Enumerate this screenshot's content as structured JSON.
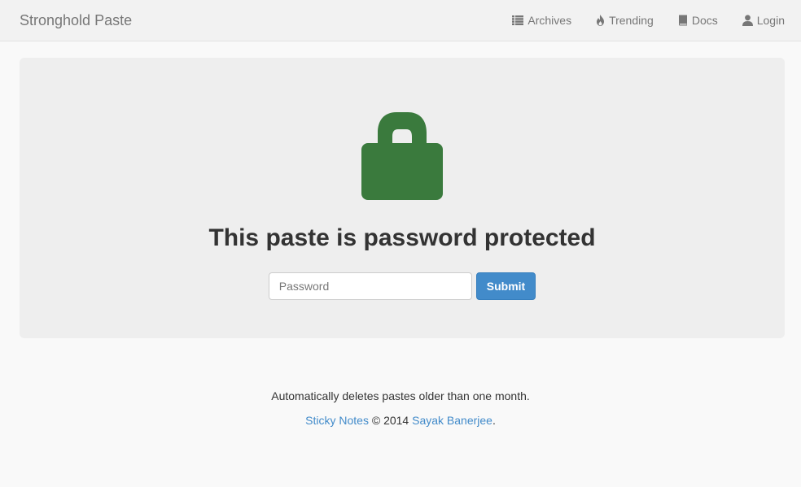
{
  "navbar": {
    "brand": "Stronghold Paste",
    "items": [
      {
        "label": "Archives",
        "icon": "list-icon"
      },
      {
        "label": "Trending",
        "icon": "fire-icon"
      },
      {
        "label": "Docs",
        "icon": "book-icon"
      },
      {
        "label": "Login",
        "icon": "user-icon"
      }
    ]
  },
  "main": {
    "title": "This paste is password protected",
    "password_placeholder": "Password",
    "password_value": "",
    "submit_label": "Submit",
    "lock_icon": "lock-icon",
    "lock_color": "#3a7a3d"
  },
  "footer": {
    "notice": "Automatically deletes pastes older than one month.",
    "app_link": "Sticky Notes",
    "copyright": " © 2014 ",
    "author_link": "Sayak Banerjee",
    "trailing": "."
  },
  "colors": {
    "link": "#428bca",
    "button": "#428bca"
  }
}
